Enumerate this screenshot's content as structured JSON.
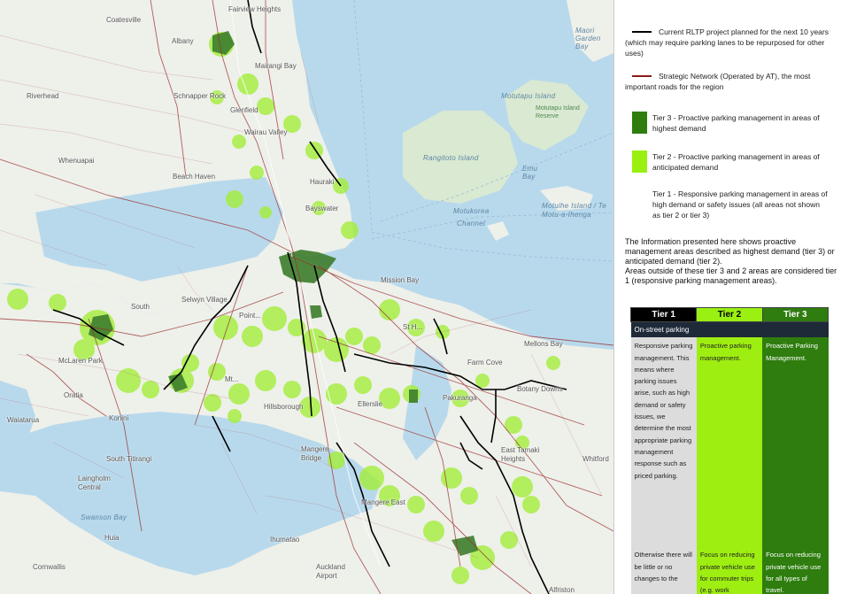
{
  "map": {
    "place_labels": [
      {
        "id": "fairview-heights",
        "text": "Fairview Heights"
      },
      {
        "id": "coatesville",
        "text": "Coatesville"
      },
      {
        "id": "albany",
        "text": "Albany"
      },
      {
        "id": "mairangi-bay",
        "text": "Mairangi Bay"
      },
      {
        "id": "schnapper-rock",
        "text": "Schnapper Rock"
      },
      {
        "id": "glenfield",
        "text": "Glenfield"
      },
      {
        "id": "riverhead",
        "text": "Riverhead"
      },
      {
        "id": "wairau-valley",
        "text": "Wairau Valley"
      },
      {
        "id": "whenuapai",
        "text": "Whenuapai"
      },
      {
        "id": "hauraki",
        "text": "Hauraki"
      },
      {
        "id": "beach-haven",
        "text": "Beach Haven"
      },
      {
        "id": "bayswater",
        "text": "Bayswater"
      },
      {
        "id": "mission-bay",
        "text": "Mission Bay"
      },
      {
        "id": "selwyn-village",
        "text": "Selwyn Village"
      },
      {
        "id": "glen-eden-south",
        "text": "South"
      },
      {
        "id": "mclaren-park",
        "text": "McLaren Park"
      },
      {
        "id": "oratia",
        "text": "Oratia"
      },
      {
        "id": "waiatarua",
        "text": "Waiatarua"
      },
      {
        "id": "konini",
        "text": "Konini"
      },
      {
        "id": "south-titirangi",
        "text": "South Titirangi"
      },
      {
        "id": "laingholm",
        "text": "Laingholm Central"
      },
      {
        "id": "swanson-bay",
        "text": "Swanson Bay"
      },
      {
        "id": "huia",
        "text": "Huia"
      },
      {
        "id": "cornwallis",
        "text": "Cornwallis"
      },
      {
        "id": "ihumatao",
        "text": "Ihumatao"
      },
      {
        "id": "mangere",
        "text": "Mangere Bridge"
      },
      {
        "id": "mangere-east",
        "text": "Mangere East"
      },
      {
        "id": "auckland-airport",
        "text": "Auckland Airport"
      },
      {
        "id": "ellerslie",
        "text": "Ellerslie"
      },
      {
        "id": "hillsborough",
        "text": "Hillsborough"
      },
      {
        "id": "farm-cove",
        "text": "Farm Cove"
      },
      {
        "id": "botany-downs",
        "text": "Botany Downs"
      },
      {
        "id": "pakuranga",
        "text": "Pakuranga"
      },
      {
        "id": "mellons-bay",
        "text": "Mellons Bay"
      },
      {
        "id": "east-tamaki",
        "text": "East Tamaki Heights"
      },
      {
        "id": "whitford",
        "text": "Whitford"
      },
      {
        "id": "alfriston",
        "text": "Alfriston"
      },
      {
        "id": "st-heliers",
        "text": "St H..."
      },
      {
        "id": "point-chevalier",
        "text": "Point..."
      },
      {
        "id": "mt-albert",
        "text": "Mt..."
      }
    ],
    "water_labels": [
      {
        "id": "rangitoto",
        "text": "Rangitoto Island"
      },
      {
        "id": "motukorea",
        "text": "Motukorea Channel"
      },
      {
        "id": "motutapu",
        "text": "Motutapu Island"
      },
      {
        "id": "motutapu-reserve",
        "text": "Motutapu Island Reserve"
      },
      {
        "id": "motuihe",
        "text": "Motuihe Island / Te Motu-a-Ihenga"
      },
      {
        "id": "emu-bay",
        "text": "Emu Bay"
      },
      {
        "id": "maori-garden",
        "text": "Maori Garden Bay"
      }
    ]
  },
  "legend": {
    "rltp": {
      "label": "Current RLTP project planned for the next 10 years (which may require parking lanes to be repurposed for other uses)",
      "color": "#000000"
    },
    "strategic": {
      "label": "Strategic Network (Operated by AT), the most important roads for the region",
      "color": "#8b1a1a"
    },
    "tier3": {
      "label": "Tier 3 - Proactive parking management in areas of highest demand",
      "color": "#2e7d0e"
    },
    "tier2": {
      "label": "Tier 2 - Proactive parking management in areas of anticipated demand",
      "color": "#99f011"
    },
    "tier1": {
      "label": "Tier 1 - Responsive parking management in areas of high demand or safety issues (all areas not shown as tier 2 or tier 3)"
    }
  },
  "info": {
    "para1": "The Information presented here shows proactive management areas described as highest demand (tier 3) or anticipated demand (tier 2).",
    "para2": "Areas outside of these tier 3 and 2 areas are considered tier 1 (responsive parking management areas)."
  },
  "table": {
    "headers": [
      "Tier 1",
      "Tier 2",
      "Tier 3"
    ],
    "section": "On-street parking",
    "rows": [
      [
        "Responsive parking management. This means where parking issues arise, such as high demand or safety issues, we determine the most appropriate parking management response such as priced parking.",
        "Proactive parking management.",
        "Proactive Parking Management."
      ],
      [
        "Otherwise there will be little or no changes to the",
        "Focus on reducing private vehicle use for commuter trips (e.g. work",
        "Focus on reducing private vehicle use for all types of travel."
      ]
    ]
  }
}
